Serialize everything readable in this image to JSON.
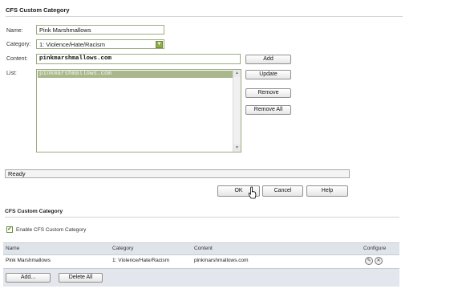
{
  "dialog": {
    "title": "CFS Custom Category",
    "name_label": "Name:",
    "name_value": "Pink Marshmallows",
    "category_label": "Category:",
    "category_value": "1: Violence/Hate/Racism",
    "content_label": "Content:",
    "content_value": "pinkmarshmallows.com",
    "list_label": "List:",
    "list_items": [
      "pinkmarshmallows.com"
    ],
    "buttons": {
      "add": "Add",
      "update": "Update",
      "remove": "Remove",
      "remove_all": "Remove All"
    },
    "status": "Ready",
    "footer_buttons": {
      "ok": "OK",
      "cancel": "Cancel",
      "help": "Help"
    }
  },
  "section": {
    "title": "CFS Custom Category",
    "enable_label": "Enable CFS Custom Category",
    "enable_checked": true,
    "table": {
      "headers": [
        "Name",
        "Category",
        "Content",
        "Configure"
      ],
      "rows": [
        {
          "name": "Pink Marshmallows",
          "category": "1: Violence/Hate/Racism",
          "content": "pinkmarshmallows.com"
        }
      ]
    },
    "add_label": "Add...",
    "delete_all_label": "Delete All"
  },
  "icons": {
    "edit": "pencil-icon",
    "delete": "delete-x-icon",
    "cursor": "hand-pointer-cursor",
    "dropdown": "chevron-down-icon"
  },
  "colors": {
    "accent_green": "#8fae4a",
    "list_selection": "#a9b88c",
    "table_header": "#dfe3ea"
  }
}
